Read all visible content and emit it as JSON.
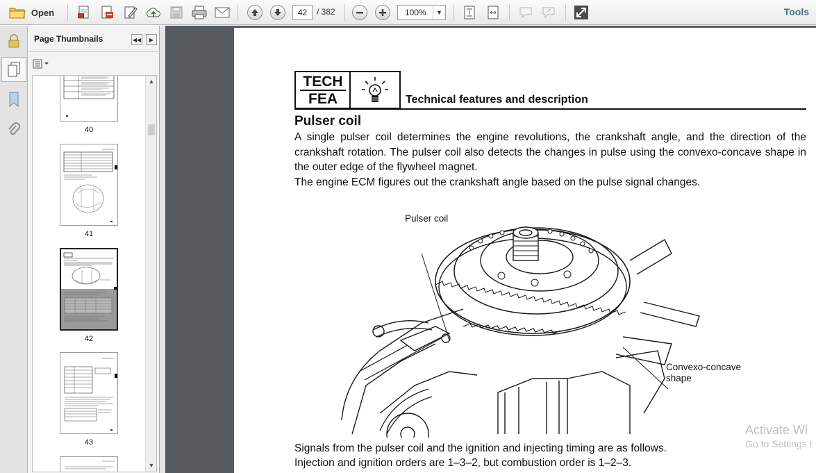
{
  "toolbar": {
    "open_label": "Open",
    "current_page": "42",
    "page_total": "/ 382",
    "zoom": "100%",
    "tools_label": "Tools",
    "icons": [
      "folder-icon",
      "create-pdf-icon",
      "export-pdf-icon",
      "edit-icon",
      "upload-cloud-icon",
      "save-icon",
      "print-icon",
      "email-icon",
      "previous-page-icon",
      "next-page-icon",
      "zoom-out-icon",
      "zoom-in-icon",
      "fit-page-icon",
      "fit-width-icon",
      "comment-icon",
      "sign-icon",
      "fullscreen-icon"
    ]
  },
  "sidebar": {
    "panel_title": "Page Thumbnails",
    "thumbnails": [
      {
        "page": "40"
      },
      {
        "page": "41"
      },
      {
        "page": "42",
        "selected": true
      },
      {
        "page": "43"
      }
    ]
  },
  "document": {
    "tech_line1": "TECH",
    "tech_line2": "FEA",
    "feature_title": "Technical features and description",
    "section_title": "Pulser coil",
    "paragraph1": "A single pulser coil determines the engine revolutions, the crankshaft angle, and the direction of the crankshaft rotation. The pulser coil also detects the changes in pulse using the convexo-concave shape in the outer edge of the flywheel magnet.",
    "paragraph2": "The engine ECM figures out the crankshaft angle based on the pulse signal changes.",
    "figure_label_pulser": "Pulser coil",
    "figure_label_convexo": "Convexo-concave\nshape",
    "bottom_line1": "Signals from the pulser coil and the ignition and injecting timing are as follows.",
    "bottom_line2": "Injection and ignition orders are 1–3–2, but combustion order is 1–2–3."
  },
  "watermark": {
    "line1": "Activate Wi",
    "line2": "Go to Settings t"
  },
  "colors": {
    "viewport_bg": "#56595e",
    "tools_label": "#4a6f96",
    "toolbar_bg": "#eaeaea"
  }
}
